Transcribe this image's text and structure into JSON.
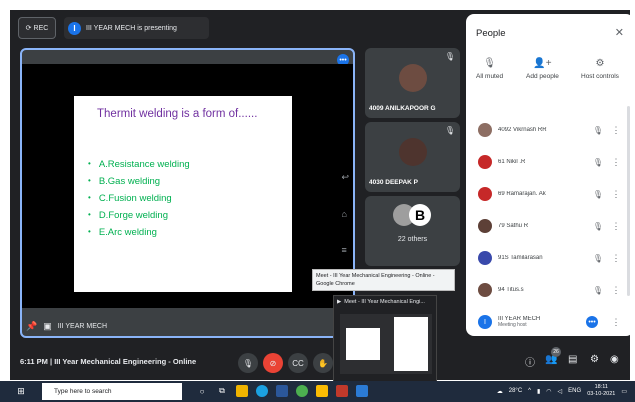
{
  "topbar": {
    "rec_label": "REC",
    "presenting_text": "III YEAR MECH is presenting",
    "presenting_badge": "I"
  },
  "slide": {
    "title": "Thermit welding is a form of......",
    "options": [
      "A.Resistance welding",
      "B.Gas welding",
      "C.Fusion welding",
      "D.Forge welding",
      "E.Arc welding"
    ]
  },
  "stage": {
    "presenter_name": "III YEAR MECH"
  },
  "tiles": [
    {
      "name": "4009 ANILKAPOOR G"
    },
    {
      "name": "4030 DEEPAK P"
    },
    {
      "name": "22 others",
      "letter": "B"
    }
  ],
  "people_panel": {
    "title": "People",
    "controls": [
      {
        "label": "All muted",
        "icon": "mic-off-icon"
      },
      {
        "label": "Add people",
        "icon": "add-person-icon"
      },
      {
        "label": "Host controls",
        "icon": "host-controls-icon"
      }
    ],
    "participants": [
      {
        "name": "4092 Vikrnash RR",
        "color": "#8d6e63"
      },
      {
        "name": "61 Nikil .R",
        "color": "#c62828"
      },
      {
        "name": "69 Ramarajan. Ak",
        "color": "#c62828"
      },
      {
        "name": "79 Sathu R",
        "color": "#5d4037"
      },
      {
        "name": "91S Tamilarasan",
        "color": "#3949ab"
      },
      {
        "name": "94 Titus.s",
        "color": "#6d4c41"
      }
    ],
    "host": {
      "name": "III YEAR MECH",
      "sub": "Meeting host",
      "initial": "I"
    }
  },
  "bottom_bar": {
    "meeting_info": "6:11 PM  |  III Year Mechanical Engineering - Online",
    "participant_count": "26"
  },
  "tooltip": "Meet - III Year Mechanical Engineering - Online - Google Chrome",
  "preview_title": "Meet - III Year Mechanical Engi...",
  "taskbar": {
    "search_placeholder": "Type here to search",
    "temperature": "28°C",
    "language": "ENG",
    "time": "18:11",
    "date": "03-10-2021"
  }
}
